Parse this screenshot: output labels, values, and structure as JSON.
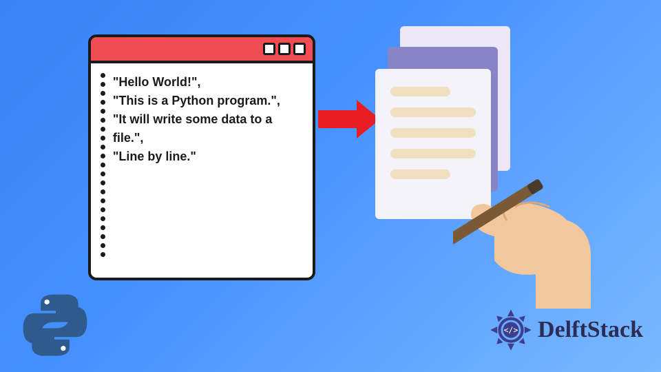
{
  "code_window": {
    "lines": [
      "\"Hello World!\",",
      "\"This is a Python program.\",",
      "\"It will write some data to a file.\",",
      "\"Line by line.\""
    ]
  },
  "brand": {
    "name": "DelftStack"
  },
  "icons": {
    "python": "python-logo",
    "arrow": "arrow-right",
    "documents": "document-stack",
    "hand_pen": "hand-writing-icon",
    "delft_badge": "delftstack-logo"
  },
  "colors": {
    "bg_gradient_from": "#3b82f6",
    "bg_gradient_to": "#7ab8ff",
    "titlebar": "#ef4d53",
    "arrow": "#e81c23",
    "doc_front": "#f4f3fb",
    "doc_mid": "#8884c6",
    "doc_back": "#ece8f7",
    "doc_line": "#f1e0c0",
    "delft_text": "#2c2c55"
  }
}
